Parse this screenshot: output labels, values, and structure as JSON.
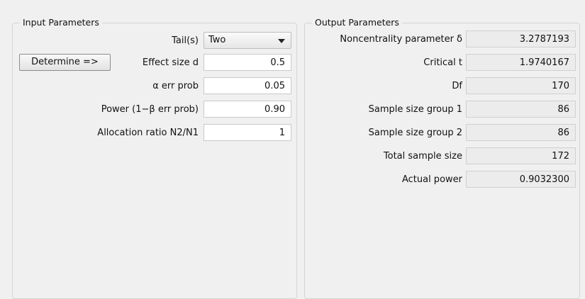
{
  "input": {
    "title": "Input Parameters",
    "tails": {
      "label": "Tail(s)",
      "value": "Two"
    },
    "determine_button": "Determine =>",
    "effect_size": {
      "label": "Effect size d",
      "value": "0.5"
    },
    "alpha": {
      "label": "α err prob",
      "value": "0.05"
    },
    "power": {
      "label": "Power (1−β err prob)",
      "value": "0.90"
    },
    "allocation": {
      "label": "Allocation ratio N2/N1",
      "value": "1"
    }
  },
  "output": {
    "title": "Output Parameters",
    "rows": [
      {
        "label": "Noncentrality parameter δ",
        "value": "3.2787193"
      },
      {
        "label": "Critical t",
        "value": "1.9740167"
      },
      {
        "label": "Df",
        "value": "170"
      },
      {
        "label": "Sample size group 1",
        "value": "86"
      },
      {
        "label": "Sample size group 2",
        "value": "86"
      },
      {
        "label": "Total sample size",
        "value": "172"
      },
      {
        "label": "Actual power",
        "value": "0.9032300"
      }
    ]
  }
}
